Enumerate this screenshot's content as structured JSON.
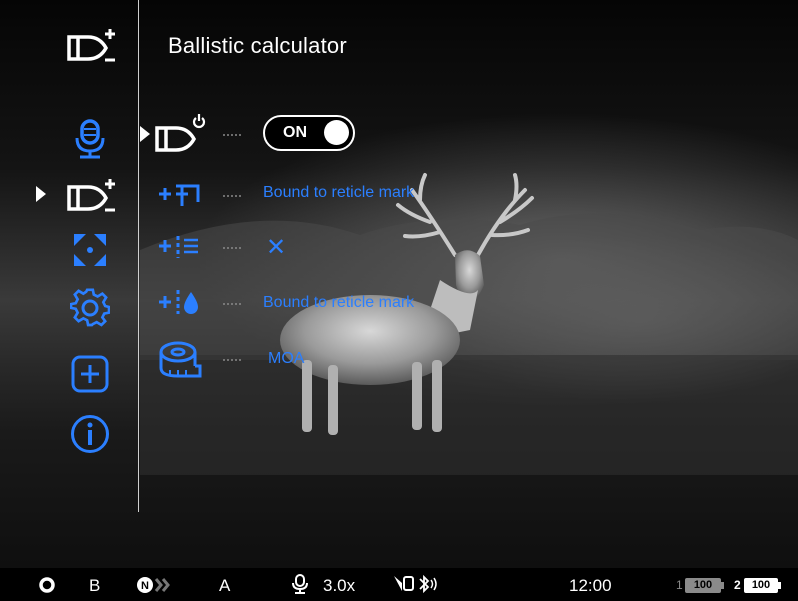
{
  "header": {
    "title": "Ballistic calculator",
    "icon": "ballistic-calculator-icon"
  },
  "sidebar": {
    "items": [
      {
        "icon": "microphone-icon",
        "color": "#2b7fff"
      },
      {
        "icon": "ballistic-calculator-icon",
        "color": "#ffffff",
        "selected": true
      },
      {
        "icon": "reticle-move-icon",
        "color": "#2b7fff"
      },
      {
        "icon": "gear-icon",
        "color": "#2b7fff"
      },
      {
        "icon": "plus-square-icon",
        "color": "#2b7fff"
      },
      {
        "icon": "info-icon",
        "color": "#2b7fff"
      }
    ]
  },
  "submenu": {
    "rows": [
      {
        "icon": "ballistic-power-icon",
        "toggle": "ON",
        "selected": true
      },
      {
        "icon": "bound-reticle-icon",
        "value": "Bound to reticle mark"
      },
      {
        "icon": "reticle-list-icon",
        "value": "✕"
      },
      {
        "icon": "drop-reticle-icon",
        "value": "Bound to reticle mark"
      },
      {
        "icon": "tape-measure-icon",
        "value": "MOA"
      }
    ]
  },
  "status_bar": {
    "mode": "B",
    "profile": "A",
    "zoom": "3.0x",
    "time": "12:00",
    "battery1_label": "1",
    "battery1_value": "100",
    "battery2_label": "2",
    "battery2_value": "100"
  },
  "colors": {
    "accent": "#2b7fff",
    "text": "#ffffff",
    "background": "#000000"
  }
}
